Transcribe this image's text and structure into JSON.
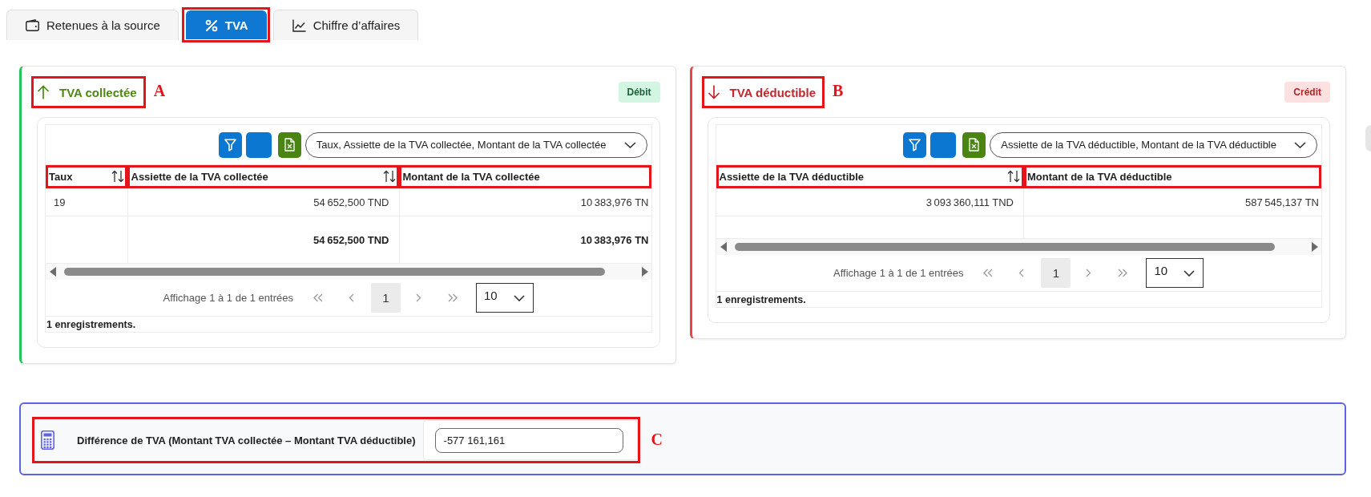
{
  "tabs": [
    {
      "label": "Retenues à la source",
      "selected": false,
      "highlighted": false
    },
    {
      "label": "TVA",
      "selected": true,
      "highlighted": true
    },
    {
      "label": "Chiffre d’affaires",
      "selected": false,
      "highlighted": false
    }
  ],
  "panels": [
    {
      "kind": "collected",
      "title": "TVA collectée",
      "highlighted": true,
      "annotation": "A",
      "badge": "Débit",
      "column_picker": "Taux, Assiette de la TVA collectée, Montant de la TVA collectée",
      "columns": [
        {
          "label": "Taux",
          "kind": "text",
          "sortable": true,
          "highlighted": true
        },
        {
          "label": "Assiette de la TVA collectée",
          "kind": "amount",
          "sortable": true,
          "highlighted": true
        },
        {
          "label": "Montant de la TVA collectée",
          "kind": "amount",
          "sortable": false,
          "highlighted": true
        }
      ],
      "rows": [
        [
          "19",
          "54 652,500 TND",
          "10 383,976 TN"
        ]
      ],
      "totals": [
        "54 652,500 TND",
        "10 383,976 TN"
      ],
      "pager": {
        "summary": "Affichage 1 à 1 de 1 entrées",
        "pages": [
          {
            "label": "1",
            "selected": true
          }
        ],
        "page_size": "10"
      },
      "record_count": "1 enregistrements."
    },
    {
      "kind": "deductible",
      "title": "TVA déductible",
      "highlighted": true,
      "annotation": "B",
      "badge": "Crédit",
      "column_picker": "Assiette de la TVA déductible, Montant de la TVA déductible",
      "columns": [
        {
          "label": "Assiette de la TVA déductible",
          "kind": "amount",
          "sortable": true,
          "highlighted": true
        },
        {
          "label": "Montant de la TVA déductible",
          "kind": "amount",
          "sortable": false,
          "highlighted": true
        }
      ],
      "rows": [
        [
          "3 093 360,111 TND",
          "587 545,137 TN"
        ]
      ],
      "pager": {
        "summary": "Affichage 1 à 1 de 1 entrées",
        "pages": [
          {
            "label": "1",
            "selected": true
          }
        ],
        "page_size": "10"
      },
      "record_count": "1 enregistrements."
    }
  ],
  "difference": {
    "label": "Différence de TVA (Montant TVA collectée – Montant TVA déductible)",
    "value": "-577 161,161",
    "highlighted": true,
    "annotation": "C"
  }
}
